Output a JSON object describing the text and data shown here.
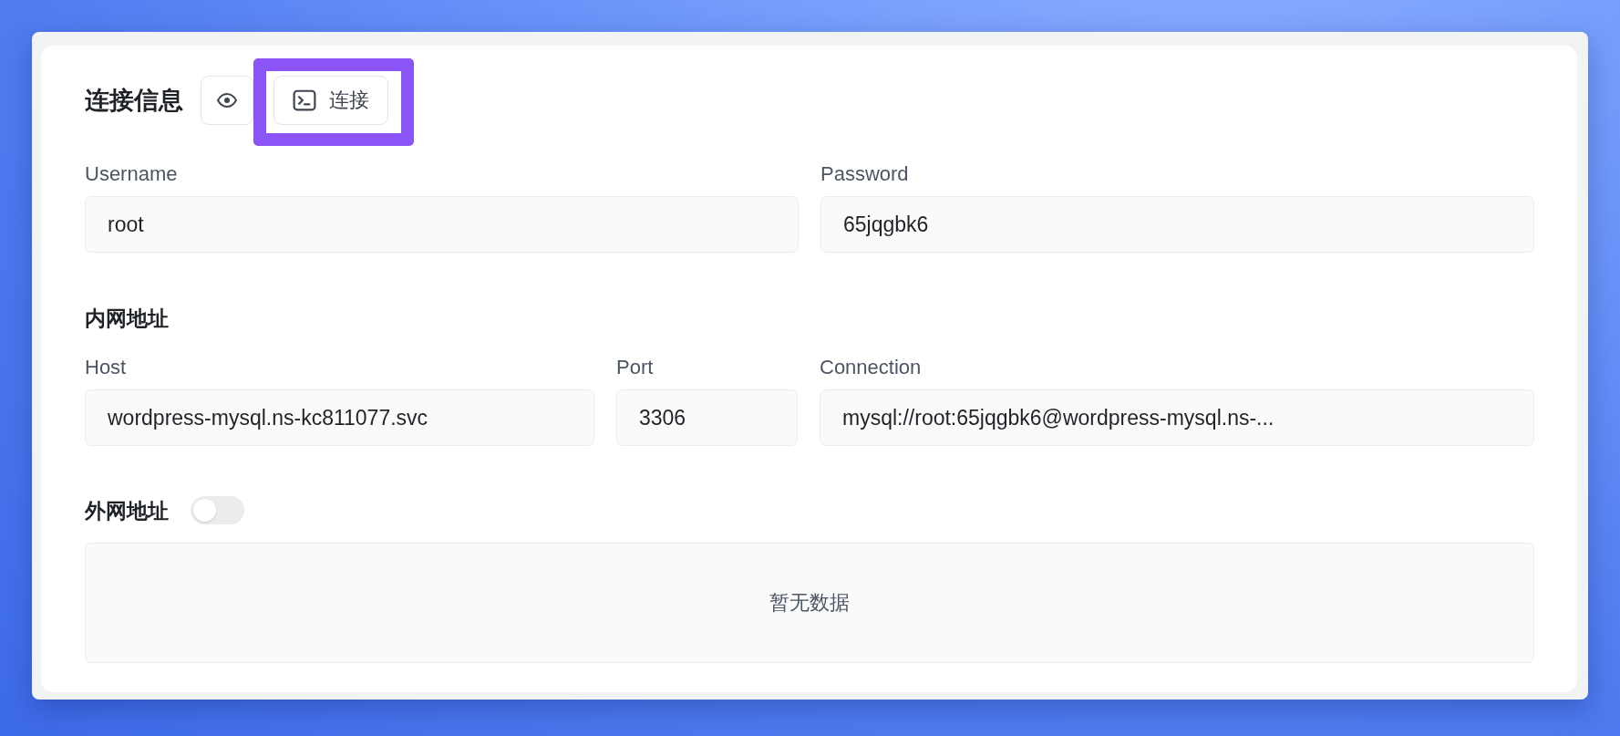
{
  "header": {
    "title": "连接信息",
    "reveal_button": {
      "kind": "icon"
    },
    "connect_button": {
      "label": "连接",
      "highlighted": true
    }
  },
  "credentials": [
    {
      "label": "Username",
      "value": "root"
    },
    {
      "label": "Password",
      "value": "65jqgbk6"
    }
  ],
  "internal": {
    "title": "内网地址",
    "fields": [
      {
        "label": "Host",
        "value": "wordpress-mysql.ns-kc811077.svc"
      },
      {
        "label": "Port",
        "value": "3306"
      },
      {
        "label": "Connection",
        "value": "mysql://root:65jqgbk6@wordpress-mysql.ns-..."
      }
    ]
  },
  "external": {
    "title": "外网地址",
    "toggle": {
      "on": false
    },
    "empty_text": "暂无数据"
  }
}
